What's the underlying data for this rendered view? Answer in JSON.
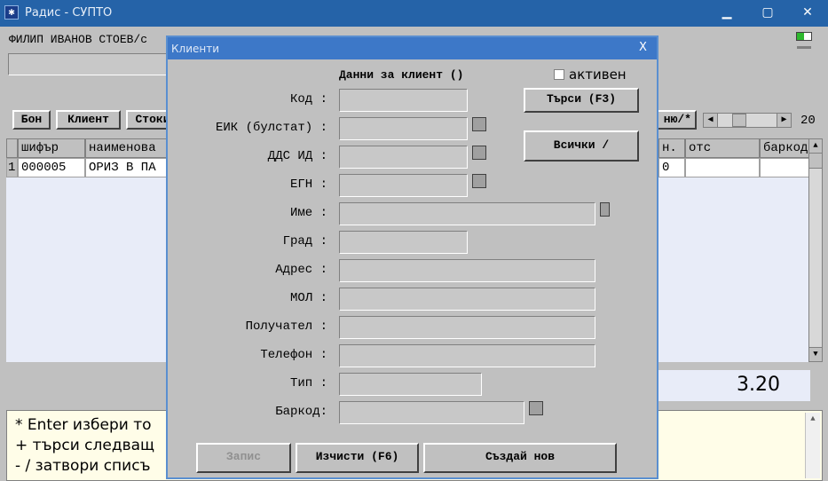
{
  "window": {
    "title": "Радис - СУПТО"
  },
  "header": {
    "operator": "ФИЛИП ИВАНОВ СТОЕВ/с"
  },
  "toolbar": {
    "buttons": [
      "Бон",
      "Клиент",
      "Стоки"
    ],
    "right_button": "ню/*",
    "slider_value": "20"
  },
  "grid": {
    "columns": [
      "шифър",
      "наименова",
      "н.",
      "отс",
      "баркод"
    ],
    "rows": [
      {
        "num": "1",
        "code": "000005",
        "name": "ОРИЗ В ПА",
        "price": "0"
      }
    ]
  },
  "total": "3.20",
  "help_lines": [
    "* Enter избери то",
    "+ търси следващ",
    "- / затвори списъ"
  ],
  "dialog": {
    "title": "Клиенти",
    "close": "X",
    "heading": "Данни за клиент ()",
    "active_label": "активен",
    "search_button": "Търси (F3)",
    "all_button": "Всички /",
    "fields": {
      "code": "Код :",
      "eik": "ЕИК (булстат) :",
      "dds": "ДДС ИД :",
      "egn": "ЕГН :",
      "name": "Име :",
      "city": "Град :",
      "address": "Адрес :",
      "mol": "МОЛ :",
      "recipient": "Получател :",
      "phone": "Телефон :",
      "type": "Тип :",
      "barcode": "Баркод:"
    },
    "save_button": "Запис",
    "clear_button": "Изчисти (F6)",
    "create_button": "Създай нов"
  }
}
